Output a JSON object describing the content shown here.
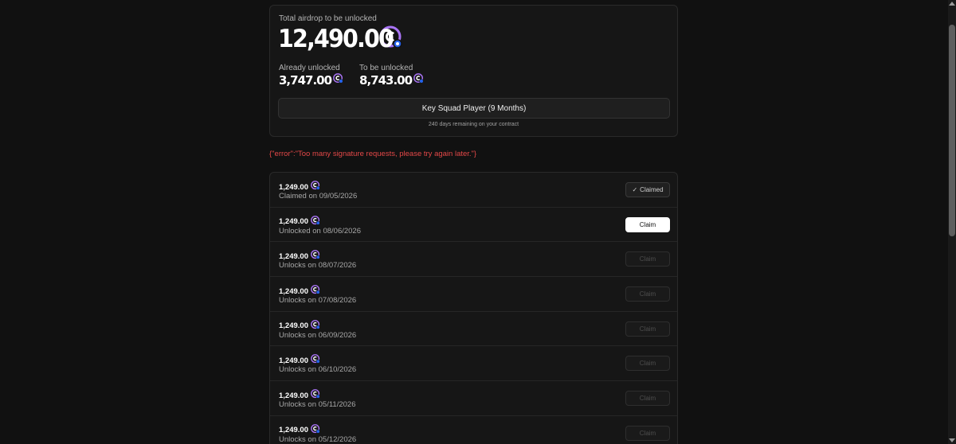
{
  "summary": {
    "total_label": "Total airdrop to be unlocked",
    "total_amount": "12,490.00",
    "already_label": "Already unlocked",
    "already_amount": "3,747.00",
    "tobe_label": "To be unlocked",
    "tobe_amount": "8,743.00",
    "contract_label": "Key Squad Player (9 Months)",
    "remaining_text": "240 days remaining on your contract"
  },
  "error_text": "{\"error\":\"Too many signature requests, please try again later.\"}",
  "token_icon": "coin-logo-icon",
  "colors": {
    "accent": "#8b5cf6",
    "error": "#e34848"
  },
  "rows": [
    {
      "amount": "1,249.00",
      "date": "Claimed on 09/05/2026",
      "button": "Claimed",
      "state": "claimed"
    },
    {
      "amount": "1,249.00",
      "date": "Unlocked on 08/06/2026",
      "button": "Claim",
      "state": "active"
    },
    {
      "amount": "1,249.00",
      "date": "Unlocks on 08/07/2026",
      "button": "Claim",
      "state": "disabled"
    },
    {
      "amount": "1,249.00",
      "date": "Unlocks on 07/08/2026",
      "button": "Claim",
      "state": "disabled"
    },
    {
      "amount": "1,249.00",
      "date": "Unlocks on 06/09/2026",
      "button": "Claim",
      "state": "disabled"
    },
    {
      "amount": "1,249.00",
      "date": "Unlocks on 06/10/2026",
      "button": "Claim",
      "state": "disabled"
    },
    {
      "amount": "1,249.00",
      "date": "Unlocks on 05/11/2026",
      "button": "Claim",
      "state": "disabled"
    },
    {
      "amount": "1,249.00",
      "date": "Unlocks on 05/12/2026",
      "button": "Claim",
      "state": "disabled"
    }
  ]
}
